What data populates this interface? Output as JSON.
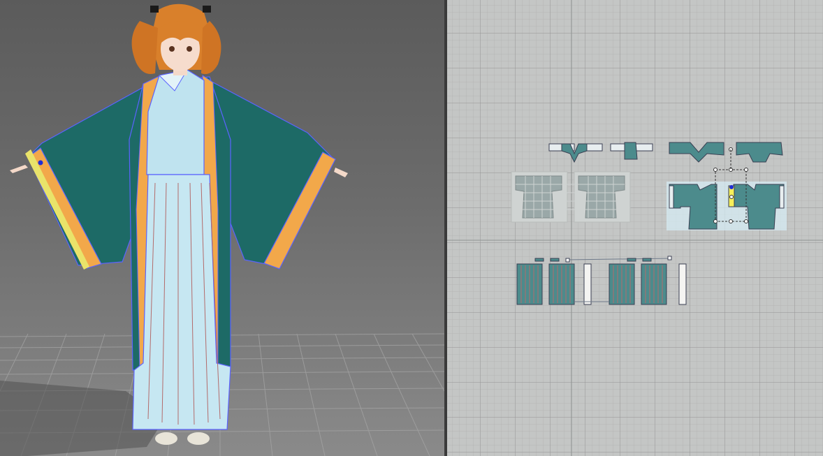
{
  "viewports": {
    "left": {
      "kind": "3D garment simulation view",
      "background": "#6c6c6c",
      "floor_grid": true
    },
    "right": {
      "kind": "2D pattern layout view",
      "background": "#c4c6c5",
      "grid": true
    }
  },
  "colors": {
    "robe": "#1d6a66",
    "robe_dark": "#144d4a",
    "trim": "#f2a84a",
    "inner_dress": "#bfe3ef",
    "pleat_line": "#b36b6b",
    "seam_outline": "#5b63ff",
    "hair": "#d9802b",
    "selected_point": "#1f2dd6",
    "pattern_piece": "#4c8b8c",
    "pattern_outline": "#3a3f52"
  },
  "icons": {
    "selection_box": "dashed-selection-box-icon",
    "pin_point": "pin-point-icon"
  }
}
